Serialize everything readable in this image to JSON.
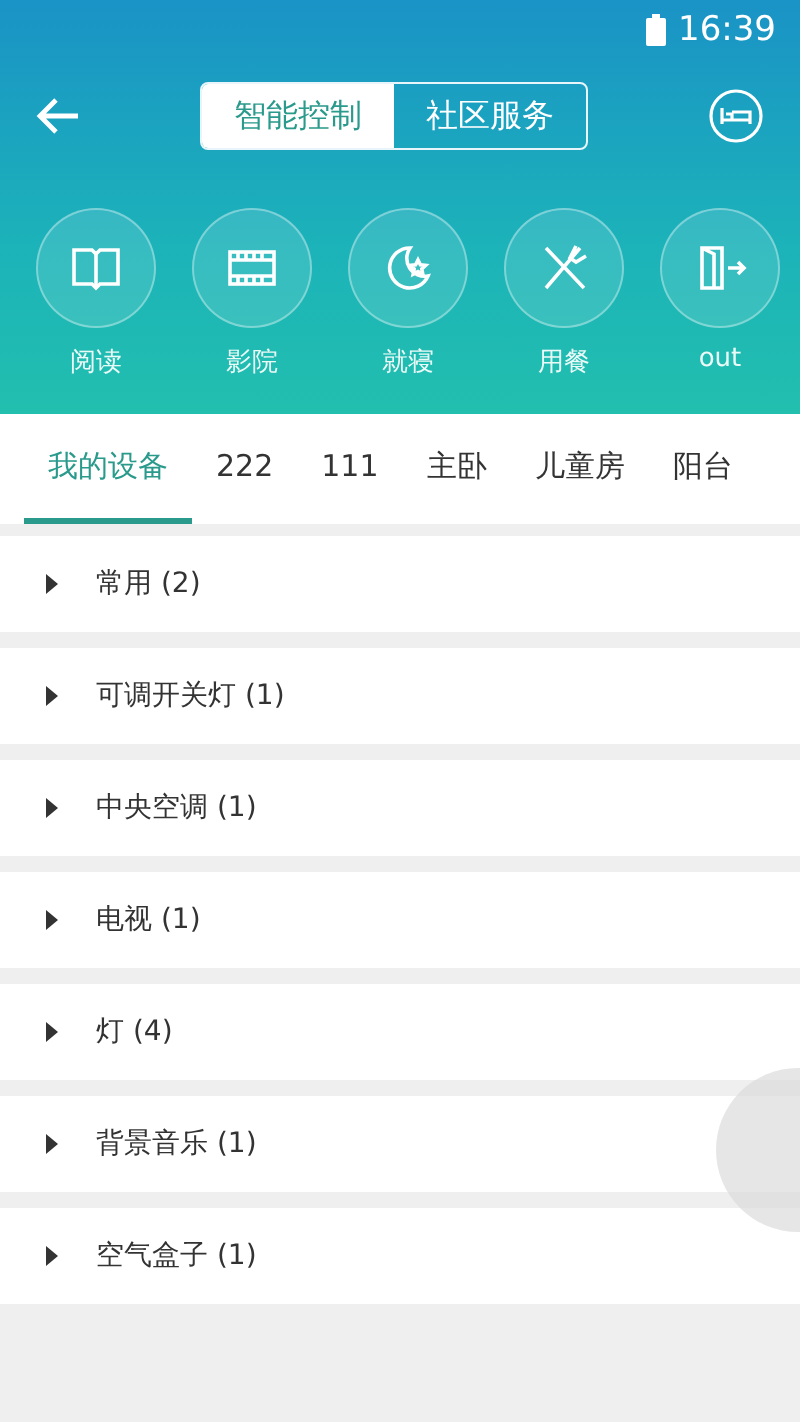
{
  "status_bar": {
    "time": "16:39"
  },
  "segments": [
    {
      "label": "智能控制",
      "selected": true
    },
    {
      "label": "社区服务",
      "selected": false
    }
  ],
  "scenes": [
    {
      "kind": "book",
      "label": "阅读"
    },
    {
      "kind": "film",
      "label": "影院"
    },
    {
      "kind": "moon",
      "label": "就寝"
    },
    {
      "kind": "dining",
      "label": "用餐"
    },
    {
      "kind": "exit",
      "label": "out"
    }
  ],
  "room_tabs": [
    {
      "label": "我的设备",
      "selected": true
    },
    {
      "label": "222",
      "selected": false
    },
    {
      "label": "111",
      "selected": false
    },
    {
      "label": "主卧",
      "selected": false
    },
    {
      "label": "儿童房",
      "selected": false
    },
    {
      "label": "阳台",
      "selected": false
    }
  ],
  "groups": [
    {
      "label": "常用 (2)",
      "expanded": false
    },
    {
      "label": "可调开关灯 (1)",
      "expanded": false
    },
    {
      "label": "中央空调 (1)",
      "expanded": false
    },
    {
      "label": "电视 (1)",
      "expanded": false
    },
    {
      "label": "灯 (4)",
      "expanded": false
    },
    {
      "label": "背景音乐 (1)",
      "expanded": false
    },
    {
      "label": "空气盒子 (1)",
      "expanded": false
    }
  ]
}
